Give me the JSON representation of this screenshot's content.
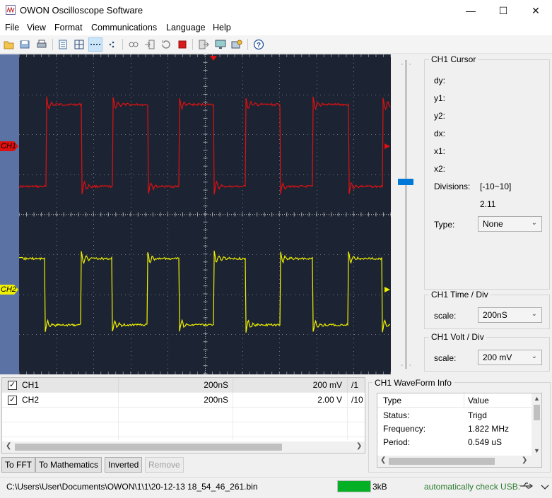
{
  "window": {
    "title": "OWON Oscilloscope Software",
    "minimize": "—",
    "maximize": "☐",
    "close": "✕"
  },
  "menu": [
    "File",
    "View",
    "Format",
    "Communications",
    "Language",
    "Help"
  ],
  "toolbar": [
    "open-icon",
    "save-icon",
    "print-icon",
    "list-view-icon",
    "grid-icon",
    "dashed-grid-icon",
    "dots-icon",
    "connect-icon",
    "import-icon",
    "refresh-icon",
    "stop-icon",
    "export-icon",
    "screen-capture-icon",
    "device-settings-icon",
    "help-icon"
  ],
  "scope": {
    "ch1_label": "CH1",
    "ch2_label": "CH2",
    "ch1_color": "#e01010",
    "ch2_color": "#f0f000",
    "grid_color": "#c0c0c0"
  },
  "cursor_panel": {
    "title": "CH1 Cursor",
    "dy": "dy:",
    "y1": "y1:",
    "y2": "y2:",
    "dx": "dx:",
    "x1": "x1:",
    "x2": "x2:",
    "divisions_label": "Divisions:",
    "divisions_range": "[-10~10]",
    "divisions_value": "2.11",
    "type_label": "Type:",
    "type_value": "None"
  },
  "time_div": {
    "title": "CH1 Time / Div",
    "scale_label": "scale:",
    "scale_value": "200nS"
  },
  "volt_div": {
    "title": "CH1 Volt / Div",
    "scale_label": "scale:",
    "scale_value": "200 mV"
  },
  "channels": [
    {
      "name": "CH1",
      "time": "200nS",
      "volt": "200 mV",
      "probe": "/1",
      "checked": true
    },
    {
      "name": "CH2",
      "time": "200nS",
      "volt": "2.00 V",
      "probe": "/10",
      "checked": true
    }
  ],
  "buttons": {
    "fft": "To FFT",
    "math": "To Mathematics",
    "inverted": "Inverted",
    "remove": "Remove"
  },
  "waveform_info": {
    "title": "CH1 WaveForm Info",
    "col_type": "Type",
    "col_value": "Value",
    "rows": [
      {
        "type": "Status:",
        "value": "Trigd"
      },
      {
        "type": "Frequency:",
        "value": "1.822 MHz"
      },
      {
        "type": "Period:",
        "value": "0.549 uS"
      }
    ]
  },
  "status": {
    "file_path": "C:\\Users\\User\\Documents\\OWON\\1\\1\\20-12-13 18_54_46_261.bin",
    "size": "3kB",
    "usb": "automatically check USB:",
    "progress": 1.0
  }
}
